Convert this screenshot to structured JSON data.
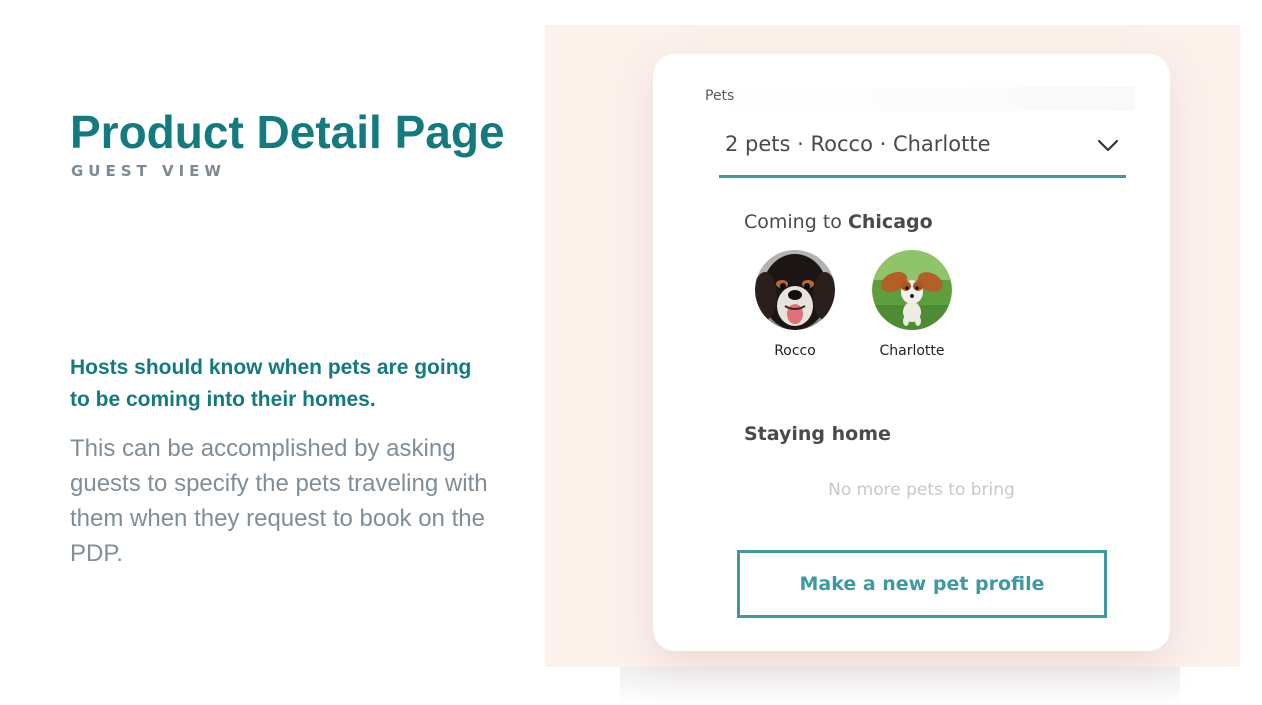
{
  "left": {
    "title": "Product Detail Page",
    "subtitle": "GUEST VIEW",
    "lead": "Hosts should know when pets are going to be coming into their homes.",
    "body": "This can be accomplished by asking guests to specify the pets traveling with them when they request to book on the PDP."
  },
  "card": {
    "field_label": "Pets",
    "select_value": "2 pets · Rocco · Charlotte",
    "select_icon": "chevron-down-icon",
    "coming": {
      "prefix": "Coming to",
      "city": "Chicago"
    },
    "pets": [
      {
        "name": "Rocco",
        "photo": "dog-photo-black-tan"
      },
      {
        "name": "Charlotte",
        "photo": "dog-photo-puppy-on-grass"
      }
    ],
    "staying_heading": "Staying home",
    "staying_empty": "No more pets to bring",
    "cta_label": "Make a new pet profile"
  },
  "colors": {
    "teal_title": "#137b80",
    "teal_accent": "#3e9aa1",
    "panel_background": "#fdf1ec",
    "muted_text": "#7f8e98"
  }
}
